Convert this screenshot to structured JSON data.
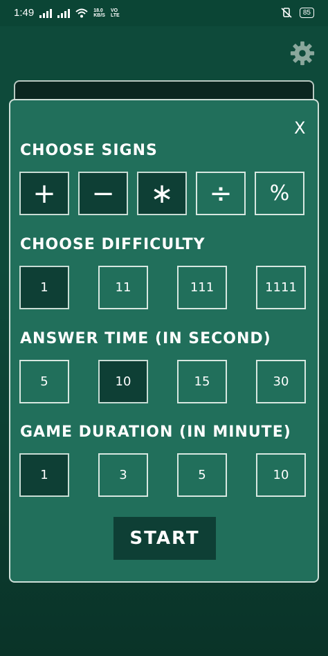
{
  "status_bar": {
    "time": "1:49",
    "speed_value": "18.0",
    "speed_unit": "KB/S",
    "network_label_1": "VO",
    "network_label_2": "LTE",
    "battery": "85"
  },
  "sections": {
    "signs": {
      "title": "CHOOSE SIGNS",
      "options": [
        {
          "label": "+",
          "selected": true
        },
        {
          "label": "−",
          "selected": true
        },
        {
          "label": "∗",
          "selected": true
        },
        {
          "label": "÷",
          "selected": false
        },
        {
          "label": "%",
          "selected": false
        }
      ]
    },
    "difficulty": {
      "title": "CHOOSE DIFFICULTY",
      "options": [
        {
          "label": "1",
          "selected": true
        },
        {
          "label": "11",
          "selected": false
        },
        {
          "label": "111",
          "selected": false
        },
        {
          "label": "1111",
          "selected": false
        }
      ]
    },
    "answer_time": {
      "title": "ANSWER TIME (IN SECOND)",
      "options": [
        {
          "label": "5",
          "selected": false
        },
        {
          "label": "10",
          "selected": true
        },
        {
          "label": "15",
          "selected": false
        },
        {
          "label": "30",
          "selected": false
        }
      ]
    },
    "game_duration": {
      "title": "GAME DURATION (IN MINUTE)",
      "options": [
        {
          "label": "1",
          "selected": true
        },
        {
          "label": "3",
          "selected": false
        },
        {
          "label": "5",
          "selected": false
        },
        {
          "label": "10",
          "selected": false
        }
      ]
    }
  },
  "dialog": {
    "close_label": "X",
    "start_label": "START"
  },
  "icons": {
    "settings": "gear-icon"
  },
  "colors": {
    "background": "#0e4a3a",
    "dialog": "#216f5b",
    "selected": "#0e3f35",
    "border": "#d8e8e1"
  }
}
